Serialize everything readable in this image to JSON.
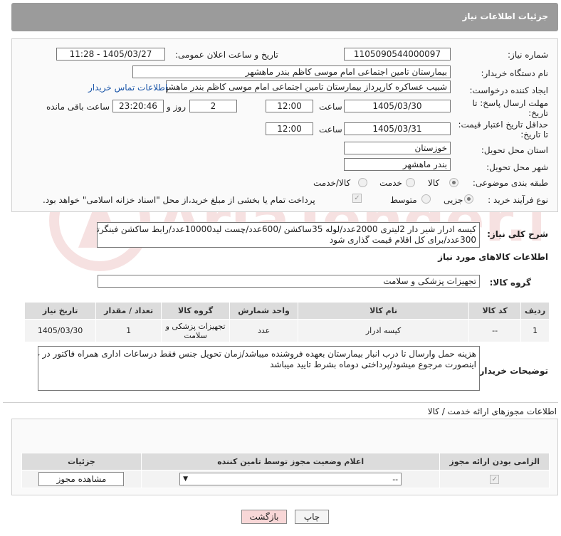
{
  "header": {
    "title": "جزئیات اطلاعات نیاز"
  },
  "form": {
    "need_number": {
      "label": "شماره نیاز:",
      "value": "1105090544000097"
    },
    "announce_date": {
      "label": "تاریخ و ساعت اعلان عمومی:",
      "value": "1405/03/27 - 11:28"
    },
    "buyer_org": {
      "label": "نام دستگاه خریدار:",
      "value": "بیمارستان تامین اجتماعی امام موسی کاظم بندر ماهشهر"
    },
    "requester": {
      "label": "ایجاد کننده درخواست:",
      "value": "شبیب عساکره کارپرداز بیمارستان تامین اجتماعی امام موسی کاظم بندر ماهشهر",
      "contact_link": "اطلاعات تماس خریدار"
    },
    "send_deadline": {
      "label_line1": "مهلت ارسال پاسخ: تا",
      "label_line2": "تاریخ:",
      "date": "1405/03/30",
      "time_label": "ساعت",
      "time": "12:00",
      "days": "2",
      "days_label": "روز و",
      "remaining": "23:20:46",
      "remaining_label": "ساعت باقی مانده"
    },
    "price_deadline": {
      "label_line1": "حداقل تاریخ اعتبار قیمت:",
      "label_line2": "تا تاریخ:",
      "date": "1405/03/31",
      "time_label": "ساعت",
      "time": "12:00"
    },
    "delivery_province": {
      "label": "استان محل تحویل:",
      "value": "خوزستان"
    },
    "delivery_city": {
      "label": "شهر محل تحویل:",
      "value": "بندر ماهشهر"
    },
    "category": {
      "label": "طبقه بندی موضوعی:",
      "options": [
        "کالا",
        "خدمت",
        "کالا/خدمت"
      ],
      "selected": "کالا"
    },
    "process_type": {
      "label": "نوع فرآیند خرید :",
      "options": [
        "جزیی",
        "متوسط"
      ],
      "selected": "جزیی",
      "note": "پرداخت تمام یا بخشی از مبلغ خرید،از محل \"اسناد خزانه اسلامی\" خواهد بود."
    }
  },
  "description": {
    "label": "شرح کلی نیاز:",
    "line1": "کیسه ادرار شیر دار 2لیتری 2000عدد/لوله 35ساکشن /600عدد/چست لید10000عدد/رابط ساکشن  فینگرتیپ",
    "line2": "300عدد/برای کل اقلام قیمت گذاری شود"
  },
  "goods": {
    "section_title": "اطلاعات کالاهای مورد نیاز",
    "group_label": "گروه کالا:",
    "group_value": "تجهیزات پزشکی و سلامت",
    "columns": [
      "ردیف",
      "کد کالا",
      "نام کالا",
      "واحد شمارش",
      "گروه کالا",
      "تعداد / مقدار",
      "تاریخ نیاز"
    ],
    "rows": [
      {
        "row": "1",
        "code": "--",
        "name": "کیسه ادرار",
        "unit": "عدد",
        "group": "تجهیزات پزشکی و سلامت",
        "qty": "1",
        "date": "1405/03/30"
      }
    ]
  },
  "buyer_notes": {
    "label": "توضیحات خریدار:",
    "line1": "هزینه حمل وارسال تا درب انبار بیمارستان بعهده فروشنده میباشد/زمان تحویل جنس فقط درساعات اداری همراه فاکتور در غیر",
    "line2": "اینصورت مرجوع میشود/پرداختی دوماه بشرط تایید میباشد"
  },
  "permits": {
    "section_title": "اطلاعات مجوزهای ارائه خدمت / کالا",
    "columns": [
      "الزامی بودن ارائه مجوز",
      "اعلام وضعیت مجوز توسط تامین کننده",
      "جزئیات"
    ],
    "status_value": "--",
    "view_button": "مشاهده مجوز"
  },
  "buttons": {
    "print": "چاپ",
    "back": "بازگشت"
  },
  "watermark": {
    "text": "AriaTender.neT"
  },
  "colors": {
    "header": "#9b9b9b",
    "link": "#1a55a8",
    "back_button": "#f8d7d7"
  }
}
